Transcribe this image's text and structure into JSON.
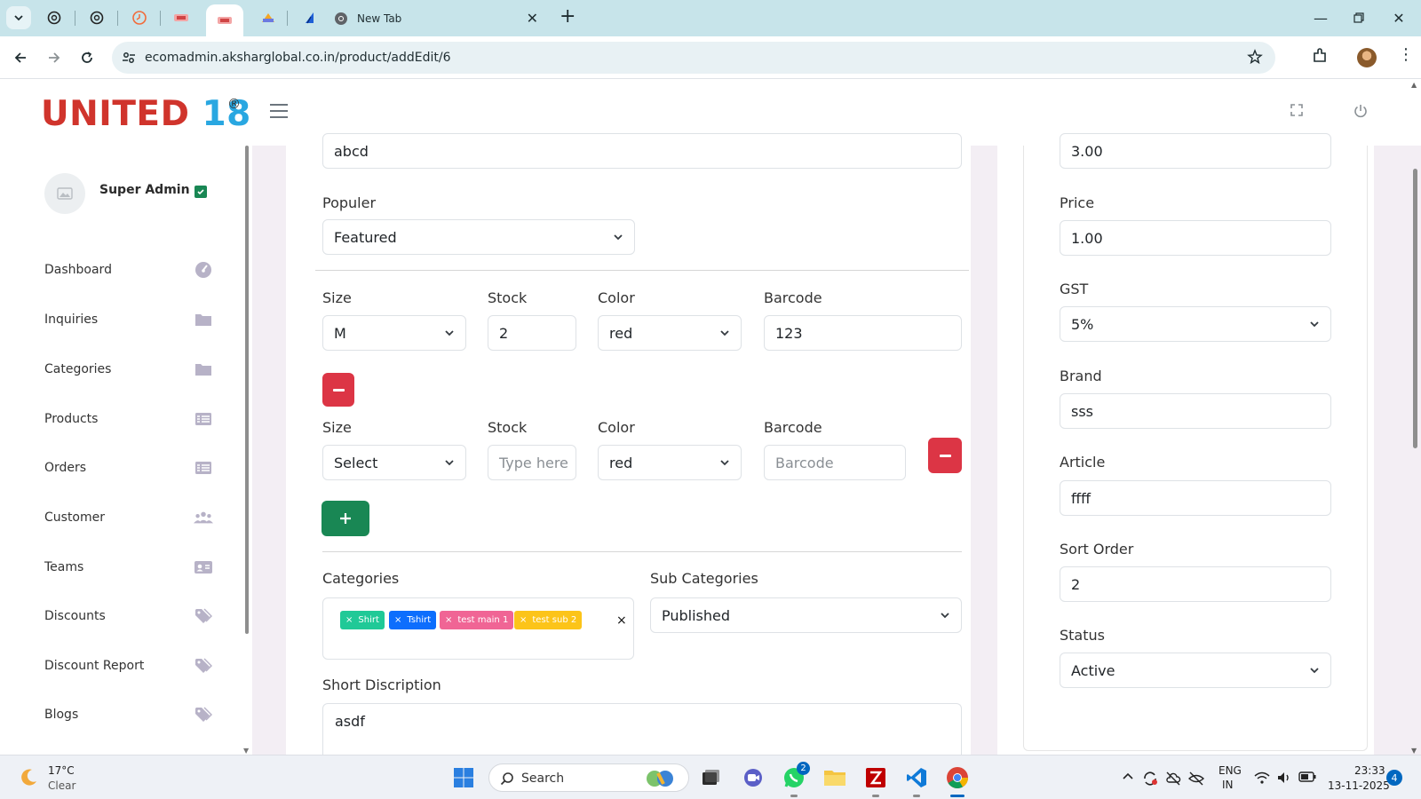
{
  "browser": {
    "new_tab_title": "New Tab",
    "url": "ecomadmin.aksharglobal.co.in/product/addEdit/6"
  },
  "app": {
    "logo_main": "UNITED",
    "logo_num": "18",
    "logo_reg": "®",
    "brand_colors": {
      "red": "#d0342c",
      "blue": "#29a7e1"
    }
  },
  "sidebar": {
    "user_name": "Super Admin",
    "items": [
      {
        "label": "Dashboard",
        "icon": "gauge-icon"
      },
      {
        "label": "Inquiries",
        "icon": "folder-icon"
      },
      {
        "label": "Categories",
        "icon": "folder-icon"
      },
      {
        "label": "Products",
        "icon": "list-icon"
      },
      {
        "label": "Orders",
        "icon": "list-icon"
      },
      {
        "label": "Customer",
        "icon": "users-icon"
      },
      {
        "label": "Teams",
        "icon": "id-card-icon"
      },
      {
        "label": "Discounts",
        "icon": "tag-icon"
      },
      {
        "label": "Discount Report",
        "icon": "tag-icon"
      },
      {
        "label": "Blogs",
        "icon": "tag-icon"
      }
    ]
  },
  "form": {
    "top_input_value": "abcd",
    "popular_label": "Populer",
    "popular_value": "Featured",
    "variants": [
      {
        "size_label": "Size",
        "size": "M",
        "stock_label": "Stock",
        "stock": "2",
        "color_label": "Color",
        "color": "red",
        "barcode_label": "Barcode",
        "barcode": "123"
      },
      {
        "size_label": "Size",
        "size": "Select",
        "stock_label": "Stock",
        "stock_placeholder": "Type here",
        "color_label": "Color",
        "color": "red",
        "barcode_label": "Barcode",
        "barcode_placeholder": "Barcode"
      }
    ],
    "categories_label": "Categories",
    "category_tags": [
      {
        "label": "Shirt",
        "color": "#20c997"
      },
      {
        "label": "Tshirt",
        "color": "#0d6efd"
      },
      {
        "label": "test main 1",
        "color": "#f06595"
      },
      {
        "label": "test sub 2",
        "color": "#fcc419"
      }
    ],
    "tag_remove": "×",
    "tags_clear": "×",
    "subcategories_label": "Sub Categories",
    "subcategories_value": "Published",
    "short_desc_label": "Short Discription",
    "short_desc_value": "asdf"
  },
  "right": {
    "top_value": "3.00",
    "price_label": "Price",
    "price_value": "1.00",
    "gst_label": "GST",
    "gst_value": "5%",
    "brand_label": "Brand",
    "brand_value": "sss",
    "article_label": "Article",
    "article_value": "ffff",
    "sort_label": "Sort Order",
    "sort_value": "2",
    "status_label": "Status",
    "status_value": "Active"
  },
  "taskbar": {
    "temp": "17°C",
    "weather": "Clear",
    "search_label": "Search",
    "whatsapp_badge": "2",
    "lang_line1": "ENG",
    "lang_line2": "IN",
    "time": "23:33",
    "date": "13-11-2025",
    "notifications": "4"
  }
}
